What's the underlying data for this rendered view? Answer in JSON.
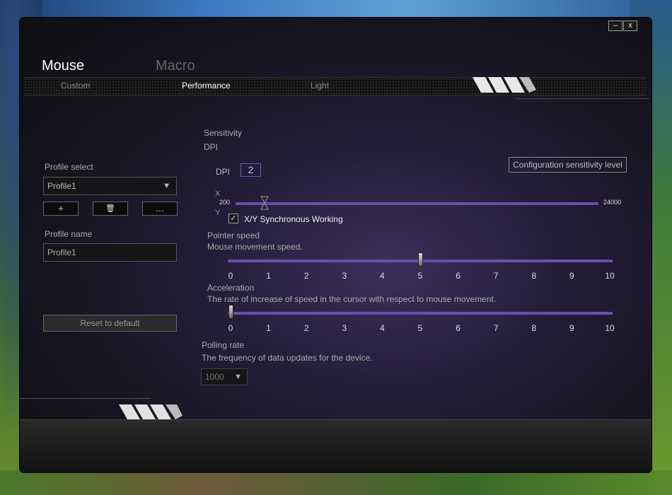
{
  "window": {
    "minimize_label": "–",
    "close_label": "x"
  },
  "modes": [
    {
      "label": "Mouse",
      "active": true
    },
    {
      "label": "Macro",
      "active": false
    }
  ],
  "nav": {
    "tabs": [
      {
        "label": "Custom",
        "active": false
      },
      {
        "label": "Performance",
        "active": true
      },
      {
        "label": "Light",
        "active": false
      }
    ]
  },
  "profile": {
    "select_label": "Profile select",
    "selected": "Profile1",
    "add_label": "+",
    "delete_label": "🗑",
    "more_label": "…",
    "name_label": "Profile name",
    "name_value": "Profile1",
    "reset_label": "Reset to default"
  },
  "sensitivity": {
    "title": "Sensitivity",
    "subtitle": "DPI",
    "dpi_label": "DPI",
    "dpi_level": "2",
    "config_button": "Configuration sensitivity level",
    "x_label": "X",
    "y_label": "Y",
    "min_label": "200",
    "max_label": "24000",
    "value_fraction": 0.08,
    "sync_label": "X/Y Synchronous Working",
    "sync_checked": true,
    "check_mark": "✓"
  },
  "pointer_speed": {
    "title": "Pointer speed",
    "description": "Mouse movement speed.",
    "value": 5,
    "ticks": [
      "0",
      "1",
      "2",
      "3",
      "4",
      "5",
      "6",
      "7",
      "8",
      "9",
      "10"
    ]
  },
  "acceleration": {
    "title": "Acceleration",
    "description": "The rate of increase of speed in the cursor with respect to mouse movement.",
    "value": 0,
    "ticks": [
      "0",
      "1",
      "2",
      "3",
      "4",
      "5",
      "6",
      "7",
      "8",
      "9",
      "10"
    ]
  },
  "polling": {
    "title": "Polling rate",
    "description": "The frequency of data updates for the device.",
    "value": "1000",
    "arrow": "▼"
  },
  "colors": {
    "accent": "#6a4fa8",
    "active_text": "#ffffff",
    "inactive_text": "#8a8a8a"
  }
}
